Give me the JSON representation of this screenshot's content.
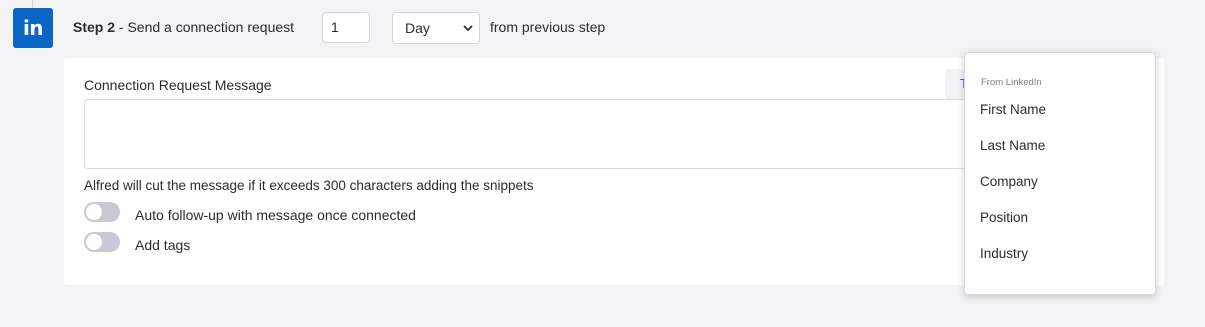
{
  "step": {
    "number_label": "Step 2",
    "separator": " - ",
    "title": "Send a connection request",
    "delay_value": "1",
    "delay_unit": "Day",
    "delay_suffix": "from previous step",
    "badge_text": "in"
  },
  "message": {
    "label": "Connection Request Message",
    "value": "",
    "snippet_tab_label": "T",
    "hint": "Alfred will cut the message if it exceeds 300 characters adding the snippets"
  },
  "toggles": [
    {
      "label": "Auto follow-up with message once connected",
      "on": false
    },
    {
      "label": "Add tags",
      "on": false
    }
  ],
  "snippet_menu": {
    "header": "From LinkedIn",
    "items": [
      "First Name",
      "Last Name",
      "Company",
      "Position",
      "Industry"
    ]
  },
  "colors": {
    "linkedin_blue": "#0a66c2",
    "toggle_off": "#c9c9d6",
    "accent": "#4a55d8"
  }
}
